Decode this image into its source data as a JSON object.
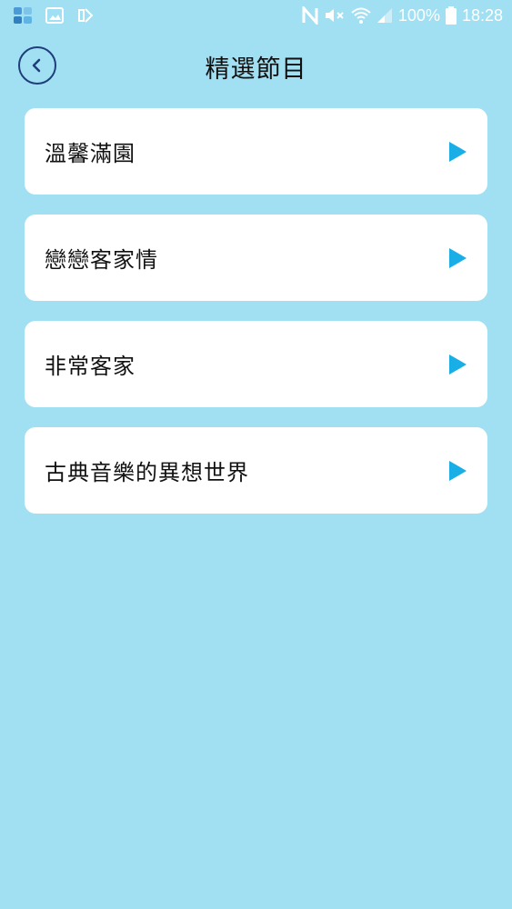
{
  "status_bar": {
    "battery_text": "100%",
    "time": "18:28",
    "left_icons": [
      "app-icon",
      "gallery-icon",
      "app-icon"
    ],
    "right_icons": [
      "nfc-icon",
      "mute-icon",
      "wifi-icon",
      "signal-icon",
      "battery-icon"
    ]
  },
  "header": {
    "title": "精選節目",
    "back_icon": "chevron-left-icon"
  },
  "programs": [
    {
      "label": "溫馨滿園",
      "icon": "play-icon"
    },
    {
      "label": "戀戀客家情",
      "icon": "play-icon"
    },
    {
      "label": "非常客家",
      "icon": "play-icon"
    },
    {
      "label": "古典音樂的異想世界",
      "icon": "play-icon"
    }
  ],
  "colors": {
    "background": "#a0e0f2",
    "card": "#ffffff",
    "accent": "#1aaee6",
    "back_button": "#1f3e7a"
  }
}
